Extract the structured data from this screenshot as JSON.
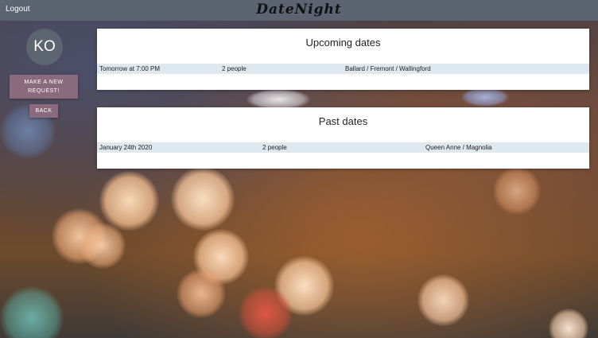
{
  "header": {
    "logout_label": "Logout",
    "brand": "DateNight"
  },
  "sidebar": {
    "avatar_initials": "KO",
    "new_request_line1": "MAKE A NEW",
    "new_request_line2": "REQUEST!",
    "back_label": "BACK"
  },
  "upcoming": {
    "title": "Upcoming dates",
    "rows": [
      {
        "when": "Tomorrow at 7:00 PM",
        "people": "2 people",
        "neighborhoods": "Ballard / Fremont / Wallingford"
      }
    ]
  },
  "past": {
    "title": "Past dates",
    "rows": [
      {
        "when": "January 24th 2020",
        "people": "2 people",
        "neighborhoods": "Queen Anne / Magnolia"
      }
    ]
  },
  "colors": {
    "topbar": "#5b6470",
    "button": "#8a6b7d",
    "avatar": "#5d6570",
    "row_highlight": "#dfe8ef"
  }
}
